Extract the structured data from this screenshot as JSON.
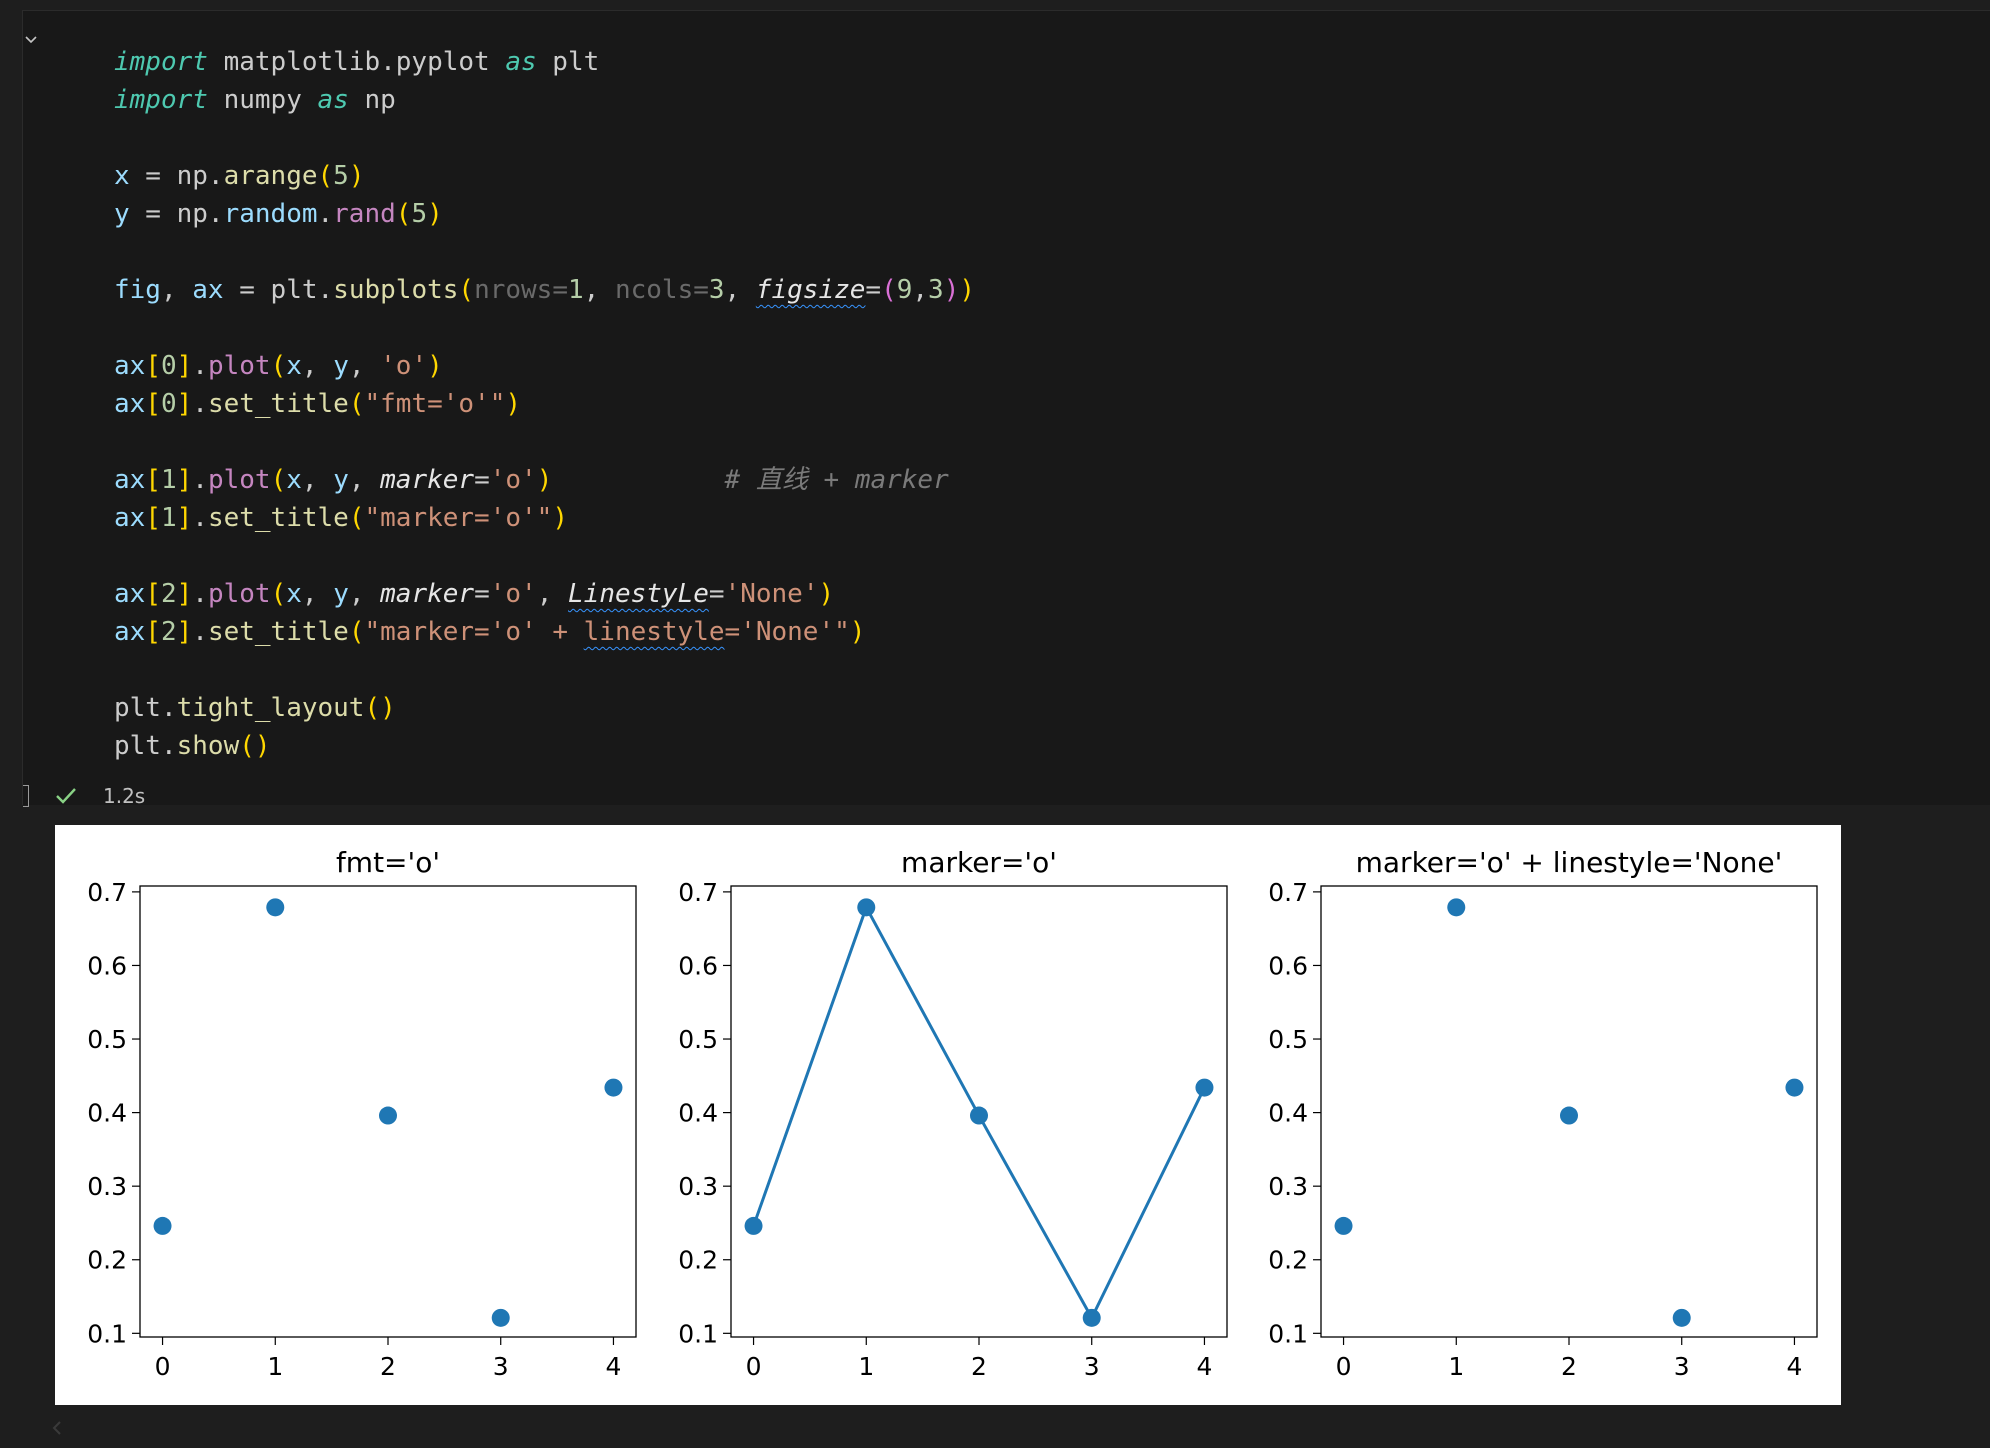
{
  "code_lines": [
    [
      [
        "import",
        "kw"
      ],
      [
        " matplotlib.pyplot ",
        ""
      ],
      [
        "as",
        "kw"
      ],
      [
        " plt",
        ""
      ]
    ],
    [
      [
        "import",
        "kw"
      ],
      [
        " numpy ",
        ""
      ],
      [
        "as",
        "kw"
      ],
      [
        " np",
        ""
      ]
    ],
    [],
    [
      [
        "x",
        "v"
      ],
      [
        " = np.",
        ""
      ],
      [
        "arange",
        "fn"
      ],
      [
        "(",
        "p1"
      ],
      [
        "5",
        "num"
      ],
      [
        ")",
        "p1"
      ]
    ],
    [
      [
        "y",
        "v"
      ],
      [
        " = np.",
        ""
      ],
      [
        "random",
        "v"
      ],
      [
        ".",
        ""
      ],
      [
        "rand",
        "mth"
      ],
      [
        "(",
        "p1"
      ],
      [
        "5",
        "num"
      ],
      [
        ")",
        "p1"
      ]
    ],
    [],
    [
      [
        "fig",
        "v"
      ],
      [
        ", ",
        ""
      ],
      [
        "ax",
        "v"
      ],
      [
        " = plt.",
        ""
      ],
      [
        "subplots",
        "fn"
      ],
      [
        "(",
        "p1"
      ],
      [
        "nrows=",
        "hint"
      ],
      [
        "1",
        "num"
      ],
      [
        ", ",
        ""
      ],
      [
        "ncols=",
        "hint"
      ],
      [
        "3",
        "num"
      ],
      [
        ", ",
        ""
      ],
      [
        "figsize",
        "prm squig"
      ],
      [
        "=",
        ""
      ],
      [
        "(",
        "p2"
      ],
      [
        "9",
        "num"
      ],
      [
        ",",
        ""
      ],
      [
        "3",
        "num"
      ],
      [
        ")",
        "p2"
      ],
      [
        ")",
        "p1"
      ]
    ],
    [],
    [
      [
        "ax",
        "v"
      ],
      [
        "[",
        "p1"
      ],
      [
        "0",
        "num"
      ],
      [
        "]",
        "p1"
      ],
      [
        ".",
        ""
      ],
      [
        "plot",
        "mth"
      ],
      [
        "(",
        "p1"
      ],
      [
        "x",
        "v"
      ],
      [
        ", ",
        ""
      ],
      [
        "y",
        "v"
      ],
      [
        ", ",
        ""
      ],
      [
        "'o'",
        "str"
      ],
      [
        ")",
        "p1"
      ]
    ],
    [
      [
        "ax",
        "v"
      ],
      [
        "[",
        "p1"
      ],
      [
        "0",
        "num"
      ],
      [
        "]",
        "p1"
      ],
      [
        ".",
        ""
      ],
      [
        "set_title",
        "fn"
      ],
      [
        "(",
        "p1"
      ],
      [
        "\"fmt='o'\"",
        "str"
      ],
      [
        ")",
        "p1"
      ]
    ],
    [],
    [
      [
        "ax",
        "v"
      ],
      [
        "[",
        "p1"
      ],
      [
        "1",
        "num"
      ],
      [
        "]",
        "p1"
      ],
      [
        ".",
        ""
      ],
      [
        "plot",
        "mth"
      ],
      [
        "(",
        "p1"
      ],
      [
        "x",
        "v"
      ],
      [
        ", ",
        ""
      ],
      [
        "y",
        "v"
      ],
      [
        ", ",
        ""
      ],
      [
        "marker",
        "prm"
      ],
      [
        "=",
        ""
      ],
      [
        "'o'",
        "str"
      ],
      [
        ")",
        "p1"
      ],
      [
        "           ",
        ""
      ],
      [
        "# 直线 + marker",
        "cmt"
      ]
    ],
    [
      [
        "ax",
        "v"
      ],
      [
        "[",
        "p1"
      ],
      [
        "1",
        "num"
      ],
      [
        "]",
        "p1"
      ],
      [
        ".",
        ""
      ],
      [
        "set_title",
        "fn"
      ],
      [
        "(",
        "p1"
      ],
      [
        "\"marker='o'\"",
        "str"
      ],
      [
        ")",
        "p1"
      ]
    ],
    [],
    [
      [
        "ax",
        "v"
      ],
      [
        "[",
        "p1"
      ],
      [
        "2",
        "num"
      ],
      [
        "]",
        "p1"
      ],
      [
        ".",
        ""
      ],
      [
        "plot",
        "mth"
      ],
      [
        "(",
        "p1"
      ],
      [
        "x",
        "v"
      ],
      [
        ", ",
        ""
      ],
      [
        "y",
        "v"
      ],
      [
        ", ",
        ""
      ],
      [
        "marker",
        "prm"
      ],
      [
        "=",
        ""
      ],
      [
        "'o'",
        "str"
      ],
      [
        ", ",
        ""
      ],
      [
        "LinestyLe",
        "prm squig"
      ],
      [
        "=",
        ""
      ],
      [
        "'None'",
        "str"
      ],
      [
        ")",
        "p1"
      ]
    ],
    [
      [
        "ax",
        "v"
      ],
      [
        "[",
        "p1"
      ],
      [
        "2",
        "num"
      ],
      [
        "]",
        "p1"
      ],
      [
        ".",
        ""
      ],
      [
        "set_title",
        "fn"
      ],
      [
        "(",
        "p1"
      ],
      [
        "\"marker='o' + ",
        "str"
      ],
      [
        "linestyle",
        "str squig"
      ],
      [
        "='None'\"",
        "str"
      ],
      [
        ")",
        "p1"
      ]
    ],
    [],
    [
      [
        "plt.",
        ""
      ],
      [
        "tight_layout",
        "fn"
      ],
      [
        "()",
        "p1"
      ]
    ],
    [
      [
        "plt.",
        ""
      ],
      [
        "show",
        "fn"
      ],
      [
        "()",
        "p1"
      ]
    ]
  ],
  "execution": {
    "time": "1.2s"
  },
  "colors": {
    "series": "#1f77b4",
    "check": "#89d185"
  },
  "chart_data": [
    {
      "type": "scatter",
      "title": "fmt='o'",
      "x": [
        0,
        1,
        2,
        3,
        4
      ],
      "y": [
        0.246,
        0.679,
        0.396,
        0.121,
        0.434
      ],
      "xticks": [
        "0",
        "1",
        "2",
        "3",
        "4"
      ],
      "yticks": [
        "0.1",
        "0.2",
        "0.3",
        "0.4",
        "0.5",
        "0.6",
        "0.7"
      ],
      "xlim": [
        -0.2,
        4.2
      ],
      "ylim": [
        0.095,
        0.708
      ],
      "line": false,
      "grid": false
    },
    {
      "type": "line",
      "title": "marker='o'",
      "x": [
        0,
        1,
        2,
        3,
        4
      ],
      "y": [
        0.246,
        0.679,
        0.396,
        0.121,
        0.434
      ],
      "xticks": [
        "0",
        "1",
        "2",
        "3",
        "4"
      ],
      "yticks": [
        "0.1",
        "0.2",
        "0.3",
        "0.4",
        "0.5",
        "0.6",
        "0.7"
      ],
      "xlim": [
        -0.2,
        4.2
      ],
      "ylim": [
        0.095,
        0.708
      ],
      "line": true,
      "grid": false
    },
    {
      "type": "scatter",
      "title": "marker='o' + linestyle='None'",
      "x": [
        0,
        1,
        2,
        3,
        4
      ],
      "y": [
        0.246,
        0.679,
        0.396,
        0.121,
        0.434
      ],
      "xticks": [
        "0",
        "1",
        "2",
        "3",
        "4"
      ],
      "yticks": [
        "0.1",
        "0.2",
        "0.3",
        "0.4",
        "0.5",
        "0.6",
        "0.7"
      ],
      "xlim": [
        -0.2,
        4.2
      ],
      "ylim": [
        0.095,
        0.708
      ],
      "line": false,
      "grid": false
    }
  ]
}
